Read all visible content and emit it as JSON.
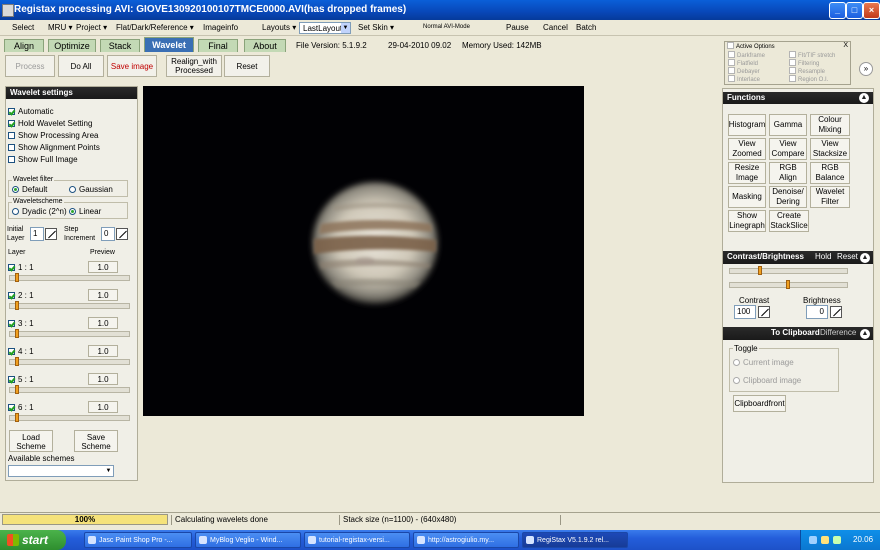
{
  "window": {
    "title": "Registax processing AVI: GIOVE130920100107TMCE0000.AVI(has dropped frames)",
    "min": "_",
    "max": "□",
    "close": "×"
  },
  "menu": {
    "items": [
      "Select",
      "MRU ▾",
      "Project ▾",
      "Flat/Dark/Reference ▾",
      "Imageinfo"
    ],
    "layouts_label": "Layouts ▾",
    "layout_value": "LastLayout",
    "skin_label": "Set Skin ▾",
    "mode_label": "Normal AVI-Mode",
    "pause": "Pause",
    "cancel": "Cancel",
    "batch": "Batch"
  },
  "tabs": [
    "Align",
    "Optimize",
    "Stack",
    "Wavelet",
    "Final",
    "About"
  ],
  "info": {
    "version": "File Version: 5.1.9.2",
    "datetime": "29-04-2010 09.02",
    "memory": "Memory Used: 142MB"
  },
  "toolbar": {
    "process": "Process",
    "doall": "Do All",
    "save_image": "Save image",
    "realign_1": "Realign_with",
    "realign_2": "Processed",
    "reset": "Reset"
  },
  "active_options": {
    "title": "Active Options",
    "close": "X",
    "col1": [
      "Darkframe",
      "Flatfield",
      "Debayer",
      "Interlace"
    ],
    "col2": [
      "FIt/TIF stretch",
      "Filtering",
      "Resample",
      "Region O.I."
    ]
  },
  "expand_btn": "»",
  "wavelet": {
    "header": "Wavelet settings",
    "checks": [
      {
        "label": "Automatic",
        "on": true
      },
      {
        "label": "Hold Wavelet Setting",
        "on": true
      },
      {
        "label": "Show Processing Area",
        "on": false
      },
      {
        "label": "Show Alignment Points",
        "on": false
      },
      {
        "label": "Show Full Image",
        "on": false
      }
    ],
    "filter_title": "Wavelet filter",
    "filter_default": "Default",
    "filter_gaussian": "Gaussian",
    "scheme_title": "Waveletscheme",
    "scheme_dyadic": "Dyadic (2^n)",
    "scheme_linear": "Linear",
    "initial_1": "Initial",
    "initial_2": "Layer",
    "initial_value": "1",
    "step_1": "Step",
    "step_2": "Increment",
    "step_value": "0",
    "layer_col": "Layer",
    "preview_col": "Preview",
    "layers": [
      {
        "label": "1 : 1",
        "preview": "1.0"
      },
      {
        "label": "2 : 1",
        "preview": "1.0"
      },
      {
        "label": "3 : 1",
        "preview": "1.0"
      },
      {
        "label": "4 : 1",
        "preview": "1.0"
      },
      {
        "label": "5 : 1",
        "preview": "1.0"
      },
      {
        "label": "6 : 1",
        "preview": "1.0"
      }
    ],
    "load_1": "Load",
    "load_2": "Scheme",
    "save_1": "Save",
    "save_2": "Scheme",
    "available": "Available schemes"
  },
  "functions": {
    "header": "Functions",
    "buttons": [
      [
        "Histogram",
        ""
      ],
      [
        "Gamma",
        ""
      ],
      [
        "Colour",
        "Mixing"
      ],
      [
        "View",
        "Zoomed"
      ],
      [
        "View",
        "Compare"
      ],
      [
        "View",
        "Stacksize"
      ],
      [
        "Resize",
        "Image"
      ],
      [
        "RGB",
        "Align"
      ],
      [
        "RGB",
        "Balance"
      ],
      [
        "Masking",
        ""
      ],
      [
        "Denoise/",
        "Dering"
      ],
      [
        "Wavelet",
        "Filter"
      ],
      [
        "Show",
        "Linegraph"
      ],
      [
        "Create",
        "StackSlice"
      ]
    ]
  },
  "contrast": {
    "header": "Contrast/Brightness",
    "hold": "Hold",
    "reset": "Reset",
    "contrast_label": "Contrast",
    "contrast_value": "100",
    "brightness_label": "Brightness",
    "brightness_value": "0"
  },
  "clipboard": {
    "header": "To Clipboard",
    "difference": "Difference",
    "toggle": "Toggle",
    "current": "Current image",
    "clip_image": "Clipboard image",
    "front": "Clipboardfront"
  },
  "status": {
    "progress": "100%",
    "progress_value": 1.0,
    "message": "Calculating wavelets done",
    "stack": "Stack size (n=1100) - (640x480)"
  },
  "taskbar": {
    "start": "start",
    "tasks": [
      "Jasc Paint Shop Pro -...",
      "MyBlog Veglio - Wind...",
      "tutorial-registax-versi...",
      "http://astrogiulio.my...",
      "RegiStax V5.1.9.2 rel..."
    ],
    "clock": "20.06"
  },
  "colors": {
    "titlebar": "#0847b8",
    "tab_active": "#3a6fb4",
    "tab": "#c3d9b5",
    "panel_header": "#1a1a1a",
    "progress": "#f5e27a",
    "slider_thumb": "#f0a020"
  }
}
